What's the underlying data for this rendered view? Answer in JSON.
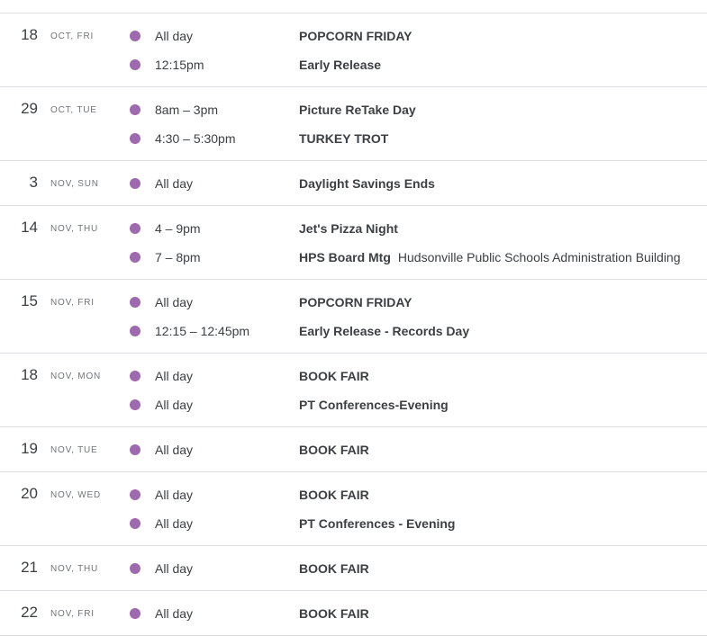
{
  "colors": {
    "event_dot": "#9e69af",
    "divider": "#dadce0",
    "text": "#3c4043",
    "subtext": "#70757a"
  },
  "days": [
    {
      "day": "18",
      "sub": "OCT, FRI",
      "events": [
        {
          "time": "All day",
          "title": "POPCORN FRIDAY",
          "location": ""
        },
        {
          "time": "12:15pm",
          "title": "Early Release",
          "location": ""
        }
      ]
    },
    {
      "day": "29",
      "sub": "OCT, TUE",
      "events": [
        {
          "time": "8am – 3pm",
          "title": "Picture ReTake Day",
          "location": ""
        },
        {
          "time": "4:30 – 5:30pm",
          "title": "TURKEY TROT",
          "location": ""
        }
      ]
    },
    {
      "day": "3",
      "sub": "NOV, SUN",
      "events": [
        {
          "time": "All day",
          "title": "Daylight Savings Ends",
          "location": ""
        }
      ]
    },
    {
      "day": "14",
      "sub": "NOV, THU",
      "events": [
        {
          "time": "4 – 9pm",
          "title": "Jet's Pizza Night",
          "location": ""
        },
        {
          "time": "7 – 8pm",
          "title": "HPS Board Mtg",
          "location": "Hudsonville Public Schools Administration Building"
        }
      ]
    },
    {
      "day": "15",
      "sub": "NOV, FRI",
      "events": [
        {
          "time": "All day",
          "title": "POPCORN FRIDAY",
          "location": ""
        },
        {
          "time": "12:15 – 12:45pm",
          "title": "Early Release - Records Day",
          "location": ""
        }
      ]
    },
    {
      "day": "18",
      "sub": "NOV, MON",
      "events": [
        {
          "time": "All day",
          "title": "BOOK FAIR",
          "location": ""
        },
        {
          "time": "All day",
          "title": "PT Conferences-Evening",
          "location": ""
        }
      ]
    },
    {
      "day": "19",
      "sub": "NOV, TUE",
      "events": [
        {
          "time": "All day",
          "title": "BOOK FAIR",
          "location": ""
        }
      ]
    },
    {
      "day": "20",
      "sub": "NOV, WED",
      "events": [
        {
          "time": "All day",
          "title": "BOOK FAIR",
          "location": ""
        },
        {
          "time": "All day",
          "title": "PT Conferences - Evening",
          "location": ""
        }
      ]
    },
    {
      "day": "21",
      "sub": "NOV, THU",
      "events": [
        {
          "time": "All day",
          "title": "BOOK FAIR",
          "location": ""
        }
      ]
    },
    {
      "day": "22",
      "sub": "NOV, FRI",
      "events": [
        {
          "time": "All day",
          "title": "BOOK FAIR",
          "location": ""
        }
      ]
    }
  ]
}
